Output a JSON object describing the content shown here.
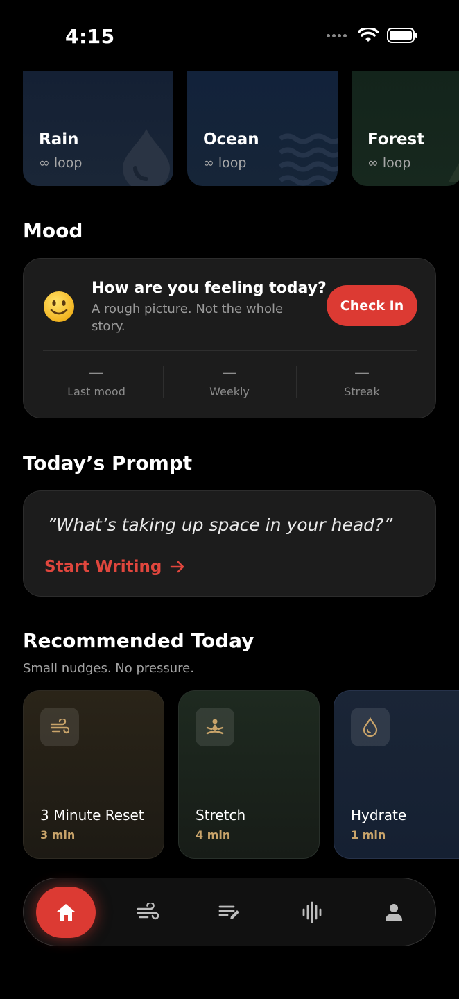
{
  "status": {
    "time": "4:15"
  },
  "sounds": [
    {
      "title": "Rain",
      "sub": "∞ loop",
      "icon": "water-drop-icon"
    },
    {
      "title": "Ocean",
      "sub": "∞ loop",
      "icon": "waves-icon"
    },
    {
      "title": "Forest",
      "sub": "∞ loop",
      "icon": "tree-icon"
    }
  ],
  "mood": {
    "heading": "Mood",
    "question": "How are you feeling today?",
    "subtitle": "A rough picture. Not the whole story.",
    "button": "Check In",
    "stats": [
      {
        "value": "—",
        "label": "Last mood"
      },
      {
        "value": "—",
        "label": "Weekly"
      },
      {
        "value": "—",
        "label": "Streak"
      }
    ]
  },
  "prompt": {
    "heading": "Today’s Prompt",
    "quote": "”What’s taking up space in your head?”",
    "action": "Start Writing"
  },
  "recommended": {
    "heading": "Recommended Today",
    "subtitle": "Small nudges. No pressure.",
    "items": [
      {
        "title": "3 Minute Reset",
        "time": "3 min",
        "icon": "wind-icon"
      },
      {
        "title": "Stretch",
        "time": "4 min",
        "icon": "meditation-icon"
      },
      {
        "title": "Hydrate",
        "time": "1 min",
        "icon": "drop-icon"
      }
    ]
  },
  "nav": {
    "items": [
      "home-icon",
      "wind-icon",
      "journal-icon",
      "audio-icon",
      "profile-icon"
    ],
    "active": "home"
  },
  "colors": {
    "accent": "#dc3a33",
    "card": "#1c1c1c",
    "gold": "#c9a46a"
  }
}
